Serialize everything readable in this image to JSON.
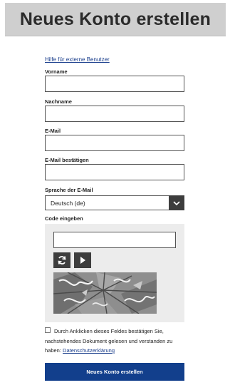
{
  "header": {
    "title": "Neues Konto erstellen"
  },
  "help_link": "Hilfe für externe Benutzer",
  "form": {
    "first_name_label": "Vorname",
    "first_name_value": "",
    "last_name_label": "Nachname",
    "last_name_value": "",
    "email_label": "E-Mail",
    "email_value": "",
    "email_confirm_label": "E-Mail bestätigen",
    "email_confirm_value": "",
    "language_label": "Sprache der E-Mail",
    "language_selected": "Deutsch (de)",
    "code_label": "Code eingeben",
    "code_value": ""
  },
  "captcha": {
    "refresh_icon": "refresh-icon",
    "play_icon": "play-icon"
  },
  "consent": {
    "checked": false,
    "text": "Durch Anklicken dieses Feldes bestätigen Sie, nachstehendes Dokument gelesen und verstanden zu haben:",
    "link": "Datenschutzerklärung"
  },
  "submit_label": "Neues Konto erstellen",
  "colors": {
    "primary": "#123f8c",
    "link": "#1a3e8c",
    "header_bg": "#cfcfcf",
    "dark_button": "#3d3d3d"
  }
}
